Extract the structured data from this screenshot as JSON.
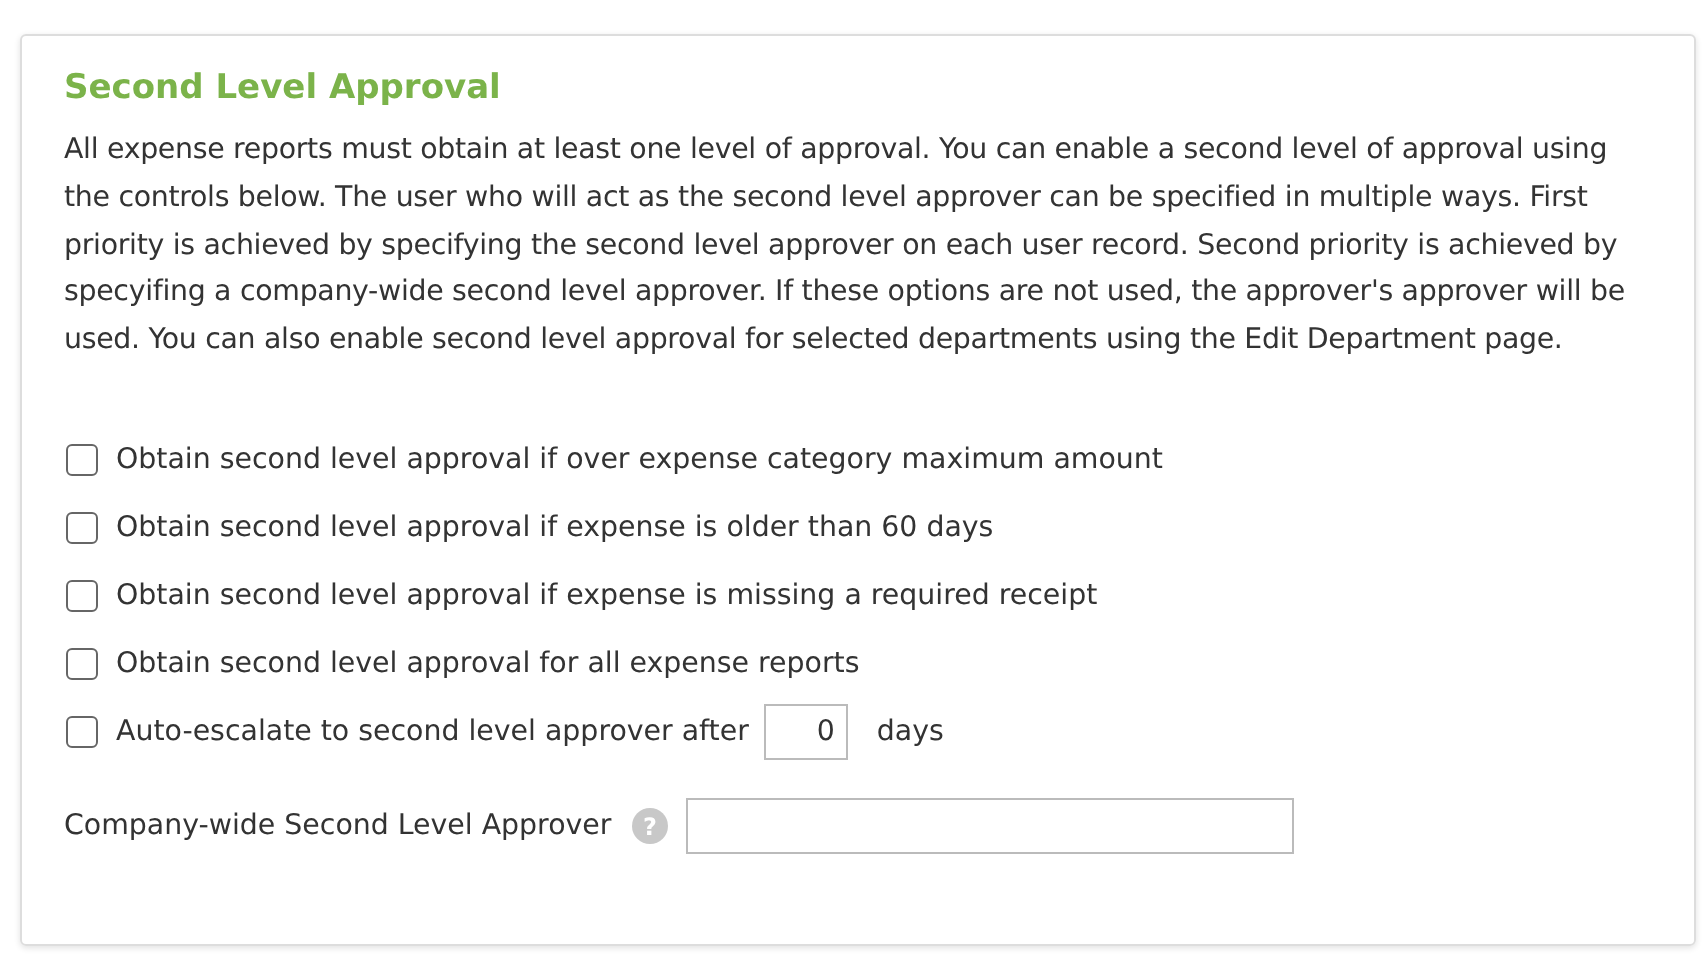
{
  "section": {
    "title": "Second Level Approval",
    "description": "All expense reports must obtain at least one level of approval. You can enable a second level of approval using the controls below. The user who will act as the second level approver can be specified in multiple ways. First priority is achieved by specifying the second level approver on each user record. Second priority is achieved by specyifing a company-wide second level approver. If these options are not used, the approver's approver will be used. You can also enable second level approval for selected departments using the Edit Department page.",
    "options": [
      {
        "kind": "checkbox",
        "label": "Obtain second level approval if over expense category maximum amount",
        "checked": false
      },
      {
        "kind": "checkbox",
        "label": "Obtain second level approval if expense is older than 60 days",
        "checked": false
      },
      {
        "kind": "checkbox",
        "label": "Obtain second level approval if expense is missing a required receipt",
        "checked": false
      },
      {
        "kind": "checkbox",
        "label": "Obtain second level approval for all expense reports",
        "checked": false
      },
      {
        "kind": "escalate",
        "label": "Auto-escalate to second level approver after",
        "checked": false,
        "value": "0",
        "suffix": "days"
      }
    ],
    "approver": {
      "label": "Company-wide Second Level Approver",
      "help": "?"
    }
  }
}
